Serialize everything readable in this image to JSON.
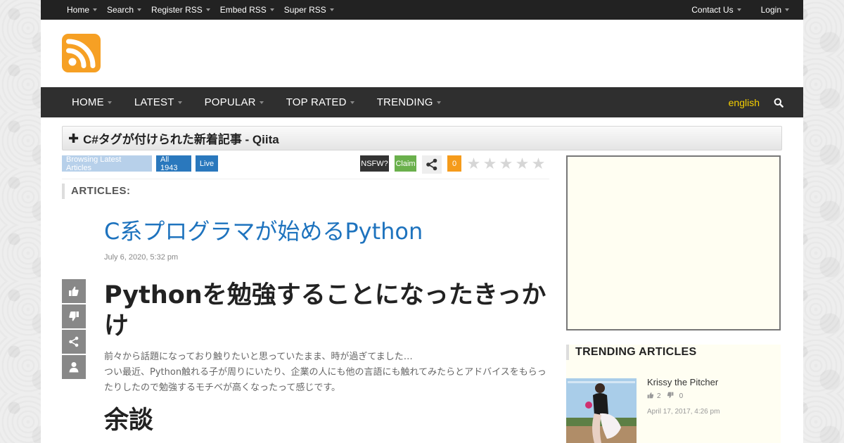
{
  "topbar": {
    "left": [
      {
        "label": "Home"
      },
      {
        "label": "Search"
      },
      {
        "label": "Register RSS"
      },
      {
        "label": "Embed RSS"
      },
      {
        "label": "Super RSS"
      }
    ],
    "right": [
      {
        "label": "Contact Us"
      },
      {
        "label": "Login"
      }
    ]
  },
  "mainnav": {
    "items": [
      {
        "label": "HOME"
      },
      {
        "label": "LATEST"
      },
      {
        "label": "POPULAR"
      },
      {
        "label": "TOP RATED"
      },
      {
        "label": "TRENDING"
      }
    ],
    "language": "english"
  },
  "feed": {
    "title": "C#タグが付けられた新着記事 - Qiita"
  },
  "stats": {
    "browsing": "Browsing Latest Articles",
    "all": "All 1943",
    "live": "Live",
    "nsfw": "NSFW?",
    "claim": "Claim",
    "count": "0",
    "rating_stars": 5,
    "rating_value": 0
  },
  "articles": {
    "heading": "ARTICLES:",
    "title": "C系プログラマが始めるPython",
    "date": "July 6, 2020, 5:32 pm",
    "h1": "Pythonを勉強することになったきっかけ",
    "para1": "前々から話題になっており触りたいと思っていたまま、時が過ぎてました…",
    "para2": "つい最近、Python触れる子が周りにいたり、企業の人にも他の言語にも触れてみたらとアドバイスをもらったりしたので勉強するモチベが高くなったって感じです。",
    "h2": "余談"
  },
  "sidebar": {
    "trending_heading": "TRENDING ARTICLES",
    "trending": [
      {
        "title": "Krissy the Pitcher",
        "likes": "2",
        "dislikes": "0",
        "date": "April 17, 2017, 4:26 pm"
      }
    ]
  },
  "colors": {
    "rss_orange": "#f6a024",
    "link_blue": "#1e73be",
    "lang_yellow": "#f7d000",
    "badge_blue": "#2a78bd",
    "badge_light_blue": "#b7d0ea",
    "badge_dark": "#333333",
    "badge_green": "#6ab04c",
    "badge_orange": "#f59b1b"
  }
}
